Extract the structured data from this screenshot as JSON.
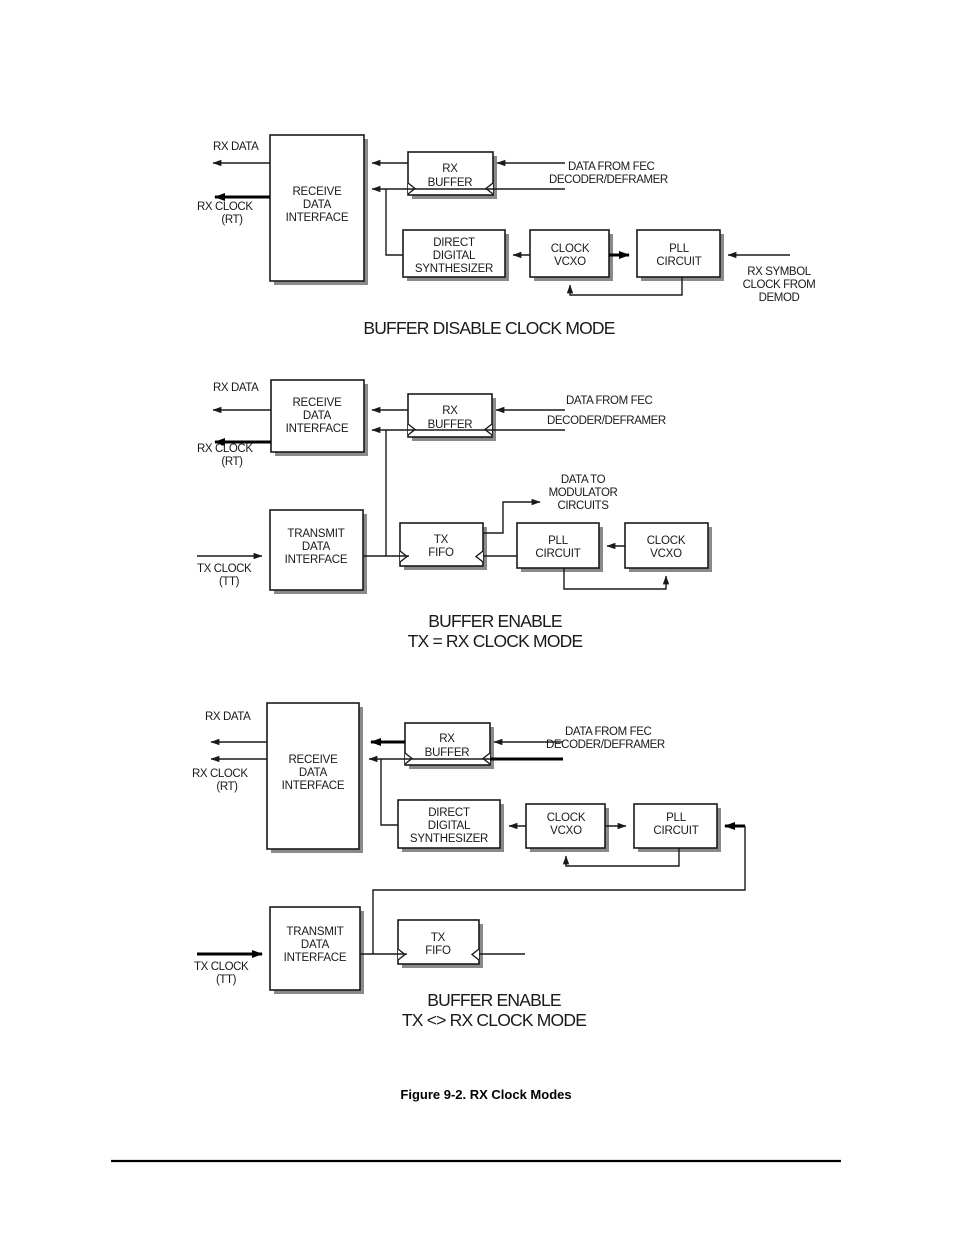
{
  "figure": {
    "caption": "Figure 9-2. RX Clock Modes"
  },
  "diagrams": [
    {
      "id": "buffer-disable-clock-mode",
      "title": "BUFFER DISABLE CLOCK MODE",
      "blocks": [
        {
          "id": "receive-data-interface",
          "lines": [
            "RECEIVE",
            "DATA",
            "INTERFACE"
          ]
        },
        {
          "id": "rx-buffer",
          "lines": [
            "RX",
            "BUFFER"
          ]
        },
        {
          "id": "direct-digital-synthesizer",
          "lines": [
            "DIRECT",
            "DIGITAL",
            "SYNTHESIZER"
          ]
        },
        {
          "id": "clock-vcxo",
          "lines": [
            "CLOCK",
            "VCXO"
          ]
        },
        {
          "id": "pll-circuit",
          "lines": [
            "PLL",
            "CIRCUIT"
          ]
        }
      ],
      "signals": [
        {
          "id": "rx-data",
          "lines": [
            "RX DATA"
          ]
        },
        {
          "id": "rx-clock",
          "lines": [
            "RX CLOCK",
            "(RT)"
          ]
        },
        {
          "id": "data-from-fec",
          "lines": [
            "DATA FROM FEC",
            "DECODER/DEFRAMER"
          ]
        },
        {
          "id": "rx-symbol-clock",
          "lines": [
            "RX SYMBOL",
            "CLOCK FROM",
            "DEMOD"
          ]
        }
      ]
    },
    {
      "id": "buffer-enable-tx-equals-rx-clock-mode",
      "title_lines": [
        "BUFFER ENABLE",
        "TX = RX CLOCK MODE"
      ],
      "blocks": [
        {
          "id": "receive-data-interface",
          "lines": [
            "RECEIVE",
            "DATA",
            "INTERFACE"
          ]
        },
        {
          "id": "rx-buffer",
          "lines": [
            "RX",
            "BUFFER"
          ]
        },
        {
          "id": "transmit-data-interface",
          "lines": [
            "TRANSMIT",
            "DATA",
            "INTERFACE"
          ]
        },
        {
          "id": "tx-fifo",
          "lines": [
            "TX",
            "FIFO"
          ]
        },
        {
          "id": "pll-circuit",
          "lines": [
            "PLL",
            "CIRCUIT"
          ]
        },
        {
          "id": "clock-vcxo",
          "lines": [
            "CLOCK",
            "VCXO"
          ]
        }
      ],
      "signals": [
        {
          "id": "rx-data",
          "lines": [
            "RX DATA"
          ]
        },
        {
          "id": "rx-clock",
          "lines": [
            "RX CLOCK",
            "(RT)"
          ]
        },
        {
          "id": "data-from-fec",
          "lines": [
            "DATA FROM FEC",
            "DECODER/DEFRAMER"
          ]
        },
        {
          "id": "tx-clock",
          "lines": [
            "TX CLOCK",
            "(TT)"
          ]
        },
        {
          "id": "data-to-modulator",
          "lines": [
            "DATA TO",
            "MODULATOR",
            "CIRCUITS"
          ]
        }
      ]
    },
    {
      "id": "buffer-enable-tx-not-equal-rx-clock-mode",
      "title_lines": [
        "BUFFER ENABLE",
        "TX <> RX CLOCK MODE"
      ],
      "blocks": [
        {
          "id": "receive-data-interface",
          "lines": [
            "RECEIVE",
            "DATA",
            "INTERFACE"
          ]
        },
        {
          "id": "rx-buffer",
          "lines": [
            "RX",
            "BUFFER"
          ]
        },
        {
          "id": "direct-digital-synthesizer",
          "lines": [
            "DIRECT",
            "DIGITAL",
            "SYNTHESIZER"
          ]
        },
        {
          "id": "clock-vcxo",
          "lines": [
            "CLOCK",
            "VCXO"
          ]
        },
        {
          "id": "pll-circuit",
          "lines": [
            "PLL",
            "CIRCUIT"
          ]
        },
        {
          "id": "transmit-data-interface",
          "lines": [
            "TRANSMIT",
            "DATA",
            "INTERFACE"
          ]
        },
        {
          "id": "tx-fifo",
          "lines": [
            "TX",
            "FIFO"
          ]
        }
      ],
      "signals": [
        {
          "id": "rx-data",
          "lines": [
            "RX DATA"
          ]
        },
        {
          "id": "rx-clock",
          "lines": [
            "RX CLOCK",
            "(RT)"
          ]
        },
        {
          "id": "data-from-fec",
          "lines": [
            "DATA FROM FEC",
            "DECODER/DEFRAMER"
          ]
        },
        {
          "id": "tx-clock",
          "lines": [
            "TX CLOCK",
            "(TT)"
          ]
        }
      ]
    }
  ],
  "text": {
    "d1_title": "BUFFER DISABLE CLOCK MODE",
    "d1_rx_data": "RX DATA",
    "d1_rx_clock_1": "RX CLOCK",
    "d1_rx_clock_2": "(RT)",
    "d1_rdi_1": "RECEIVE",
    "d1_rdi_2": "DATA",
    "d1_rdi_3": "INTERFACE",
    "d1_rxbuf_1": "RX",
    "d1_rxbuf_2": "BUFFER",
    "d1_fec_1": "DATA FROM FEC",
    "d1_fec_2": "DECODER/DEFRAMER",
    "d1_dds_1": "DIRECT",
    "d1_dds_2": "DIGITAL",
    "d1_dds_3": "SYNTHESIZER",
    "d1_vcxo_1": "CLOCK",
    "d1_vcxo_2": "VCXO",
    "d1_pll_1": "PLL",
    "d1_pll_2": "CIRCUIT",
    "d1_sym_1": "RX SYMBOL",
    "d1_sym_2": "CLOCK FROM",
    "d1_sym_3": "DEMOD",
    "d2_title_1": "BUFFER ENABLE",
    "d2_title_2": "TX = RX CLOCK MODE",
    "d2_rx_data": "RX DATA",
    "d2_rx_clock_1": "RX CLOCK",
    "d2_rx_clock_2": "(RT)",
    "d2_rdi_1": "RECEIVE",
    "d2_rdi_2": "DATA",
    "d2_rdi_3": "INTERFACE",
    "d2_rxbuf_1": "RX",
    "d2_rxbuf_2": "BUFFER",
    "d2_fec_1": "DATA FROM FEC",
    "d2_fec_2": "DECODER/DEFRAMER",
    "d2_tdi_1": "TRANSMIT",
    "d2_tdi_2": "DATA",
    "d2_tdi_3": "INTERFACE",
    "d2_tx_clock_1": "TX CLOCK",
    "d2_tx_clock_2": "(TT)",
    "d2_fifo_1": "TX",
    "d2_fifo_2": "FIFO",
    "d2_mod_1": "DATA TO",
    "d2_mod_2": "MODULATOR",
    "d2_mod_3": "CIRCUITS",
    "d2_pll_1": "PLL",
    "d2_pll_2": "CIRCUIT",
    "d2_vcxo_1": "CLOCK",
    "d2_vcxo_2": "VCXO",
    "d3_title_1": "BUFFER ENABLE",
    "d3_title_2": "TX <> RX CLOCK MODE",
    "d3_rx_data": "RX DATA",
    "d3_rx_clock_1": "RX CLOCK",
    "d3_rx_clock_2": "(RT)",
    "d3_rdi_1": "RECEIVE",
    "d3_rdi_2": "DATA",
    "d3_rdi_3": "INTERFACE",
    "d3_rxbuf_1": "RX",
    "d3_rxbuf_2": "BUFFER",
    "d3_fec_1": "DATA FROM FEC",
    "d3_fec_2": "DECODER/DEFRAMER",
    "d3_dds_1": "DIRECT",
    "d3_dds_2": "DIGITAL",
    "d3_dds_3": "SYNTHESIZER",
    "d3_vcxo_1": "CLOCK",
    "d3_vcxo_2": "VCXO",
    "d3_pll_1": "PLL",
    "d3_pll_2": "CIRCUIT",
    "d3_tdi_1": "TRANSMIT",
    "d3_tdi_2": "DATA",
    "d3_tdi_3": "INTERFACE",
    "d3_tx_clock_1": "TX CLOCK",
    "d3_tx_clock_2": "(TT)",
    "d3_fifo_1": "TX",
    "d3_fifo_2": "FIFO",
    "caption": "Figure 9-2. RX Clock Modes"
  },
  "colors": {
    "ink": "#1a1a1a",
    "shadow": "#8a8a8a",
    "background": "#ffffff"
  }
}
